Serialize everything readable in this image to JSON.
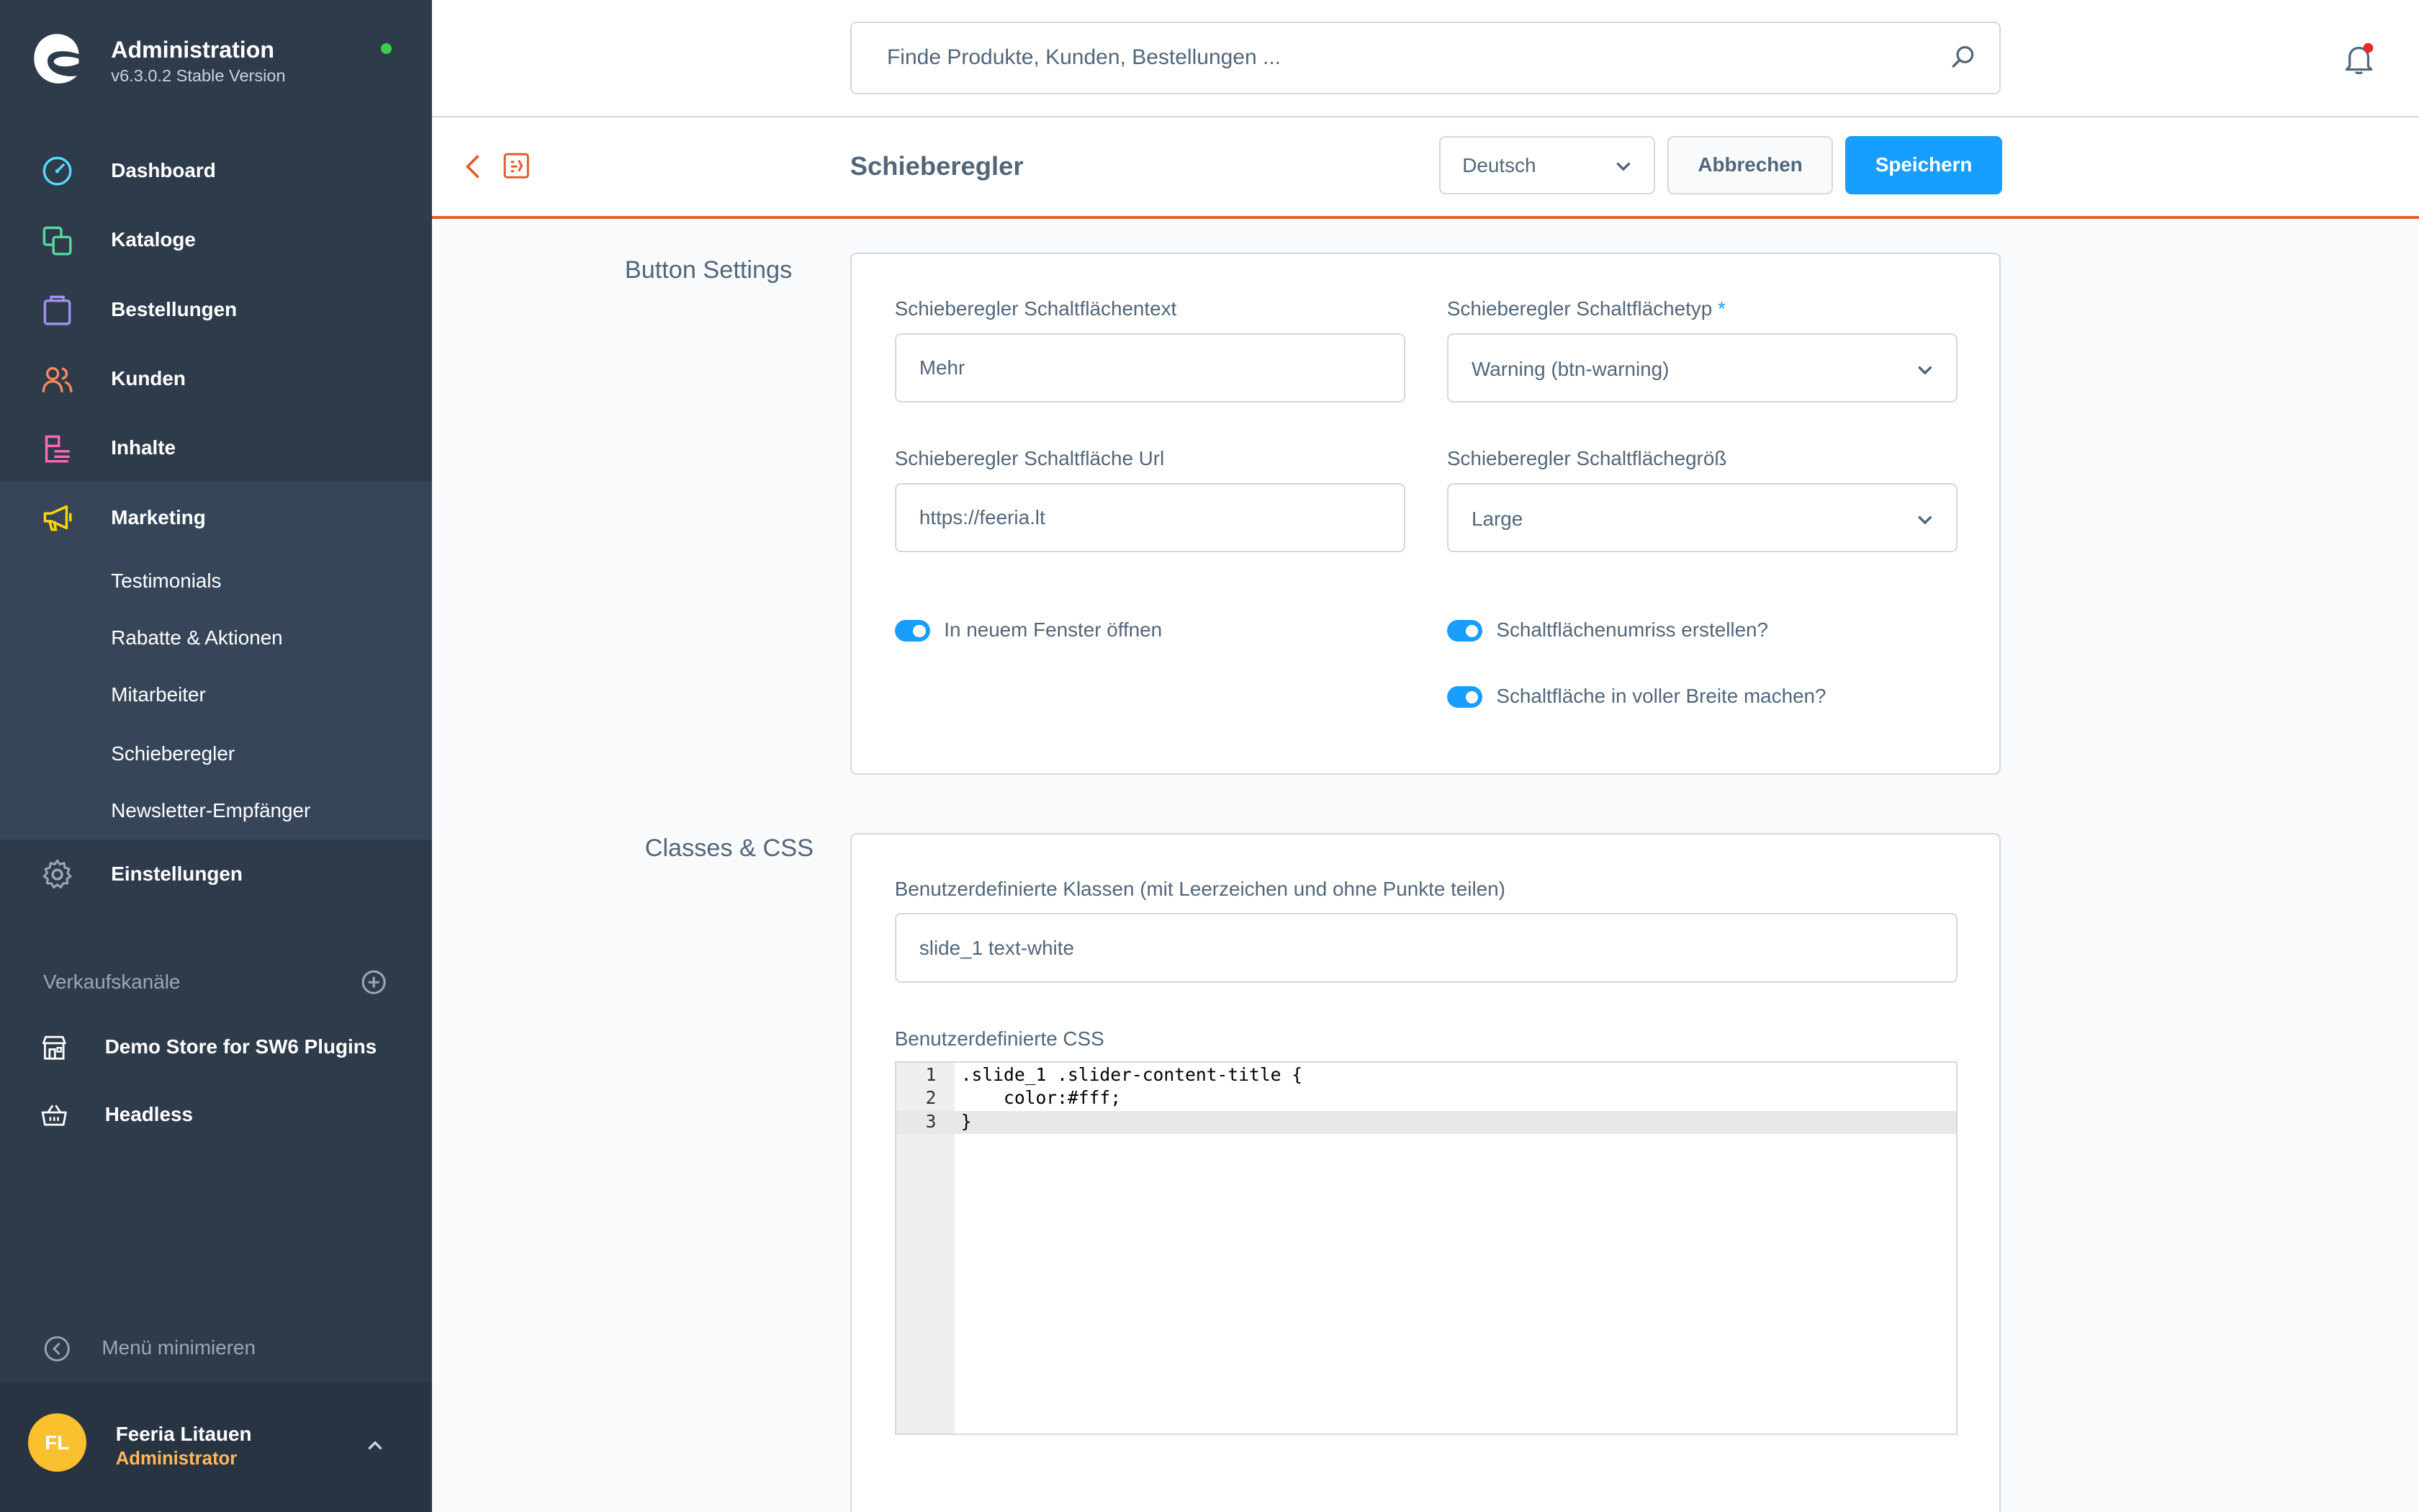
{
  "app": {
    "title": "Administration",
    "version": "v6.3.0.2 Stable Version",
    "status_color": "#37d046"
  },
  "sidebar": {
    "items": [
      {
        "label": "Dashboard",
        "icon": "dashboard-icon",
        "color": "#57d9ff"
      },
      {
        "label": "Kataloge",
        "icon": "catalog-icon",
        "color": "#57d9a3"
      },
      {
        "label": "Bestellungen",
        "icon": "orders-icon",
        "color": "#a092f0"
      },
      {
        "label": "Kunden",
        "icon": "customers-icon",
        "color": "#f88962"
      },
      {
        "label": "Inhalte",
        "icon": "content-icon",
        "color": "#ff68b4"
      },
      {
        "label": "Marketing",
        "icon": "marketing-icon",
        "color": "#ffd700"
      },
      {
        "label": "Einstellungen",
        "icon": "settings-icon",
        "color": "#9aa8b5"
      }
    ],
    "marketing_sub": [
      "Testimonials",
      "Rabatte & Aktionen",
      "Mitarbeiter",
      "Schieberegler",
      "Newsletter-Empfänger"
    ],
    "sales_channels_label": "Verkaufskanäle",
    "sales_channels": [
      {
        "label": "Demo Store for SW6 Plugins",
        "icon": "storefront-icon"
      },
      {
        "label": "Headless",
        "icon": "basket-icon"
      }
    ],
    "minimize_label": "Menü minimieren",
    "user": {
      "initials": "FL",
      "name": "Feeria Litauen",
      "role": "Administrator"
    }
  },
  "header": {
    "search_placeholder": "Finde Produkte, Kunden, Bestellungen ..."
  },
  "smartbar": {
    "title": "Schieberegler",
    "language": "Deutsch",
    "cancel_label": "Abbrechen",
    "save_label": "Speichern"
  },
  "button_settings": {
    "section_label": "Button Settings",
    "text_label": "Schieberegler Schaltflächentext",
    "text_value": "Mehr",
    "type_label": "Schieberegler Schaltflächetyp",
    "type_required": "*",
    "type_value": "Warning (btn-warning)",
    "url_label": "Schieberegler Schaltfläche Url",
    "url_value": "https://feeria.lt",
    "size_label": "Schieberegler Schaltflächegröß",
    "size_value": "Large",
    "toggle_new_window": "In neuem Fenster öffnen",
    "toggle_outline": "Schaltflächenumriss erstellen?",
    "toggle_full_width": "Schaltfläche in voller Breite machen?"
  },
  "classes_css": {
    "section_label": "Classes & CSS",
    "classes_label": "Benutzerdefinierte Klassen (mit Leerzeichen und ohne Punkte teilen)",
    "classes_value": "slide_1 text-white",
    "css_label": "Benutzerdefinierte CSS",
    "css_lines": [
      ".slide_1 .slider-content-title {",
      "    color:#fff;",
      "}"
    ]
  }
}
